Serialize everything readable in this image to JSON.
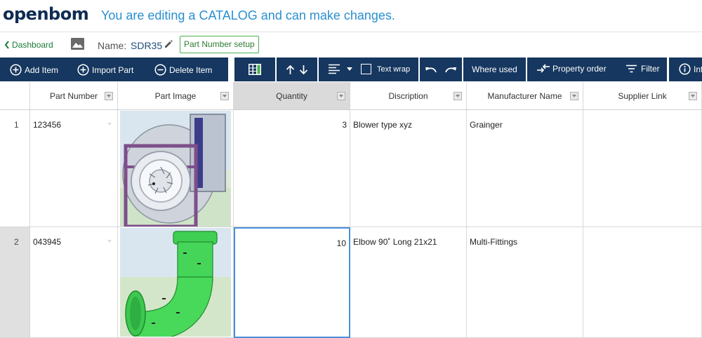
{
  "header": {
    "logo": "openbom",
    "banner": "You are editing a CATALOG and can make changes."
  },
  "subbar": {
    "back_label": "Dashboard",
    "name_label": "Name:",
    "name_value": "SDR35",
    "part_number_setup_label": "Part Number setup"
  },
  "toolbar": {
    "add_item": "Add Item",
    "import_part": "Import Part",
    "delete_item": "Delete Item",
    "text_wrap": "Text wrap",
    "where_used": "Where used",
    "property_order": "Property order",
    "filter": "Filter",
    "info": "Info"
  },
  "grid": {
    "columns": [
      "Part Number",
      "Part Image",
      "Quantity",
      "Discription",
      "Manufacturer Name",
      "Supplier Link"
    ],
    "rows": [
      {
        "index": "1",
        "part_number": "123456",
        "image": "blower-image",
        "quantity": "3",
        "description": "Blower type xyz",
        "manufacturer": "Grainger",
        "supplier_link": ""
      },
      {
        "index": "2",
        "part_number": "043945",
        "image": "elbow-pipe-image",
        "quantity": "10",
        "description": "Elbow 90˚ Long 21x21",
        "manufacturer": "Multi-Fittings",
        "supplier_link": ""
      }
    ]
  },
  "colors": {
    "toolbar_bg": "#16375f",
    "banner_text": "#2a8fd0",
    "brand_green": "#4caf50",
    "selection_blue": "#4a90d9"
  }
}
